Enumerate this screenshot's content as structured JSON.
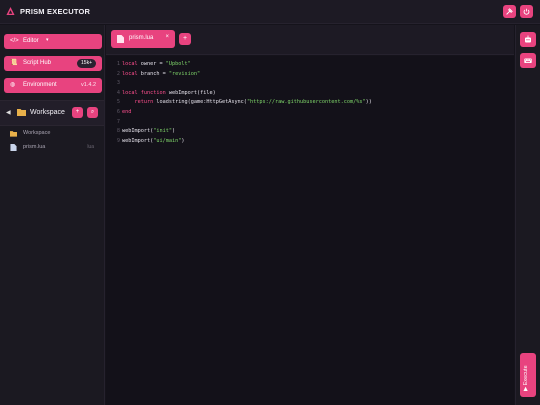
{
  "app": {
    "title": "PRISM EXECUTOR",
    "accent": "#e8437f"
  },
  "sidebar": {
    "nav": [
      {
        "icon": "code-icon",
        "glyph": "</>",
        "label": "Editor",
        "caret": "▾"
      },
      {
        "icon": "scroll-icon",
        "glyph": "📜",
        "label": "Script Hub",
        "badge": "15k+"
      },
      {
        "icon": "globe-icon",
        "glyph": "◍",
        "label": "Environment",
        "version": "v1.4.2"
      }
    ],
    "workspace": {
      "arrow": "◀",
      "title": "Workspace",
      "add": "+",
      "search": "⌕",
      "tree": [
        {
          "icon": "folder-icon",
          "label": "Workspace",
          "meta": ""
        },
        {
          "icon": "file-icon",
          "label": "prism.lua",
          "meta": "lua"
        }
      ]
    }
  },
  "tabs": {
    "items": [
      {
        "label": "prism.lua",
        "close": "×"
      }
    ],
    "add": "+"
  },
  "editor": {
    "lines": [
      {
        "n": "1",
        "parts": [
          {
            "t": "local ",
            "c": "kw"
          },
          {
            "t": "owner = ",
            "c": ""
          },
          {
            "t": "\"Upbolt\"",
            "c": "str"
          }
        ]
      },
      {
        "n": "2",
        "parts": [
          {
            "t": "local ",
            "c": "kw"
          },
          {
            "t": "branch = ",
            "c": ""
          },
          {
            "t": "\"revision\"",
            "c": "str"
          }
        ]
      },
      {
        "n": "3",
        "parts": []
      },
      {
        "n": "4",
        "parts": [
          {
            "t": "local ",
            "c": "kw"
          },
          {
            "t": "function ",
            "c": "kw"
          },
          {
            "t": "webImport(file)",
            "c": ""
          }
        ]
      },
      {
        "n": "5",
        "parts": [
          {
            "t": "    return ",
            "c": "kw"
          },
          {
            "t": "loadstring(game:HttpGetAsync(",
            "c": ""
          },
          {
            "t": "\"https://raw.githubusercontent.com/%s\"",
            "c": "str"
          },
          {
            "t": "))",
            "c": ""
          }
        ]
      },
      {
        "n": "6",
        "parts": [
          {
            "t": "end",
            "c": "kw"
          }
        ]
      },
      {
        "n": "7",
        "parts": []
      },
      {
        "n": "8",
        "parts": [
          {
            "t": "webImport(",
            "c": ""
          },
          {
            "t": "\"init\"",
            "c": "str"
          },
          {
            "t": ")",
            "c": ""
          }
        ]
      },
      {
        "n": "9",
        "parts": [
          {
            "t": "webImport(",
            "c": ""
          },
          {
            "t": "\"ui/main\"",
            "c": "str"
          },
          {
            "t": ")",
            "c": ""
          }
        ]
      }
    ]
  },
  "rightbar": {
    "buttons": [
      {
        "icon": "robot-icon"
      },
      {
        "icon": "keyboard-icon"
      }
    ],
    "execute_label": "▶ Execute"
  }
}
